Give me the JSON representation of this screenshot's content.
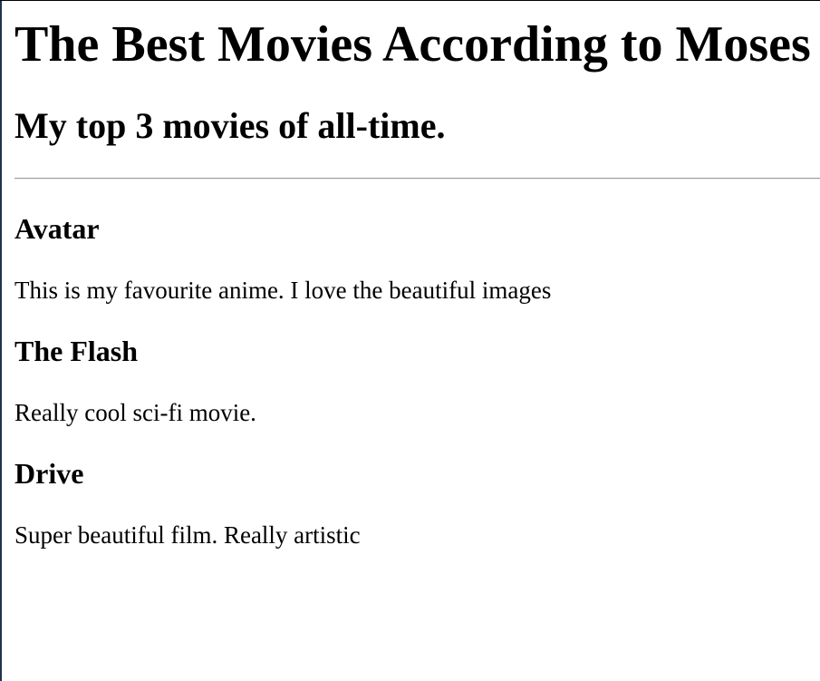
{
  "page": {
    "title": "The Best Movies According to Moses",
    "subtitle": "My top 3 movies of all-time."
  },
  "movies": [
    {
      "title": "Avatar",
      "description": "This is my favourite anime. I love the beautiful images"
    },
    {
      "title": "The Flash",
      "description": "Really cool sci-fi movie."
    },
    {
      "title": "Drive",
      "description": "Super beautiful film. Really artistic"
    }
  ]
}
